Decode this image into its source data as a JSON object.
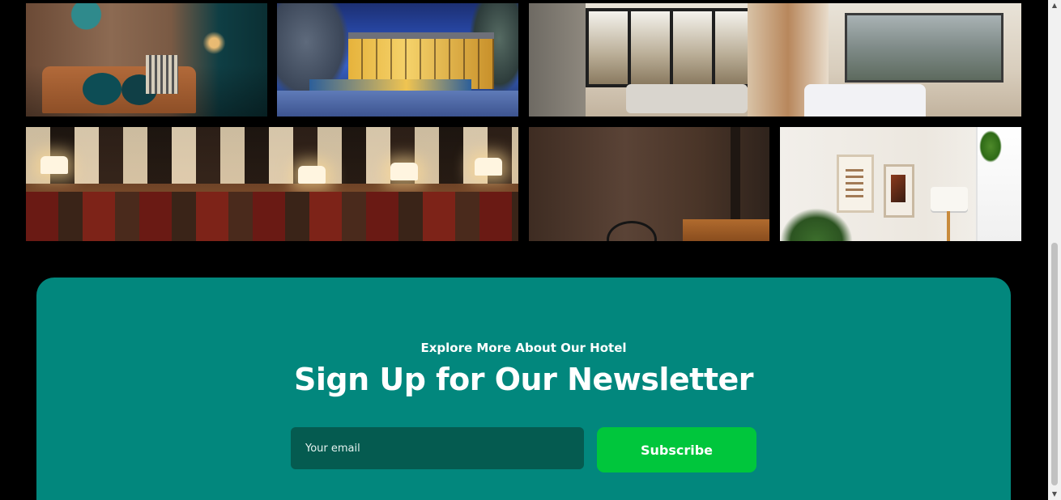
{
  "gallery": {
    "images": [
      {
        "name": "lounge-teal-photo"
      },
      {
        "name": "pool-house-photo"
      },
      {
        "name": "desert-suite-photo"
      },
      {
        "name": "classic-lounge-photo"
      },
      {
        "name": "dark-room-photo"
      },
      {
        "name": "modern-room-photo"
      }
    ]
  },
  "newsletter": {
    "eyebrow": "Explore More About Our Hotel",
    "headline": "Sign Up for Our Newsletter",
    "email_placeholder": "Your email",
    "email_value": "",
    "subscribe_label": "Subscribe",
    "colors": {
      "section_bg": "#02877d",
      "input_bg": "#055b50",
      "button_bg": "#00c63c",
      "text": "#ffffff"
    }
  },
  "page": {
    "background": "#000000"
  },
  "scrollbar": {
    "up_icon": "▲",
    "down_icon": "▼"
  }
}
